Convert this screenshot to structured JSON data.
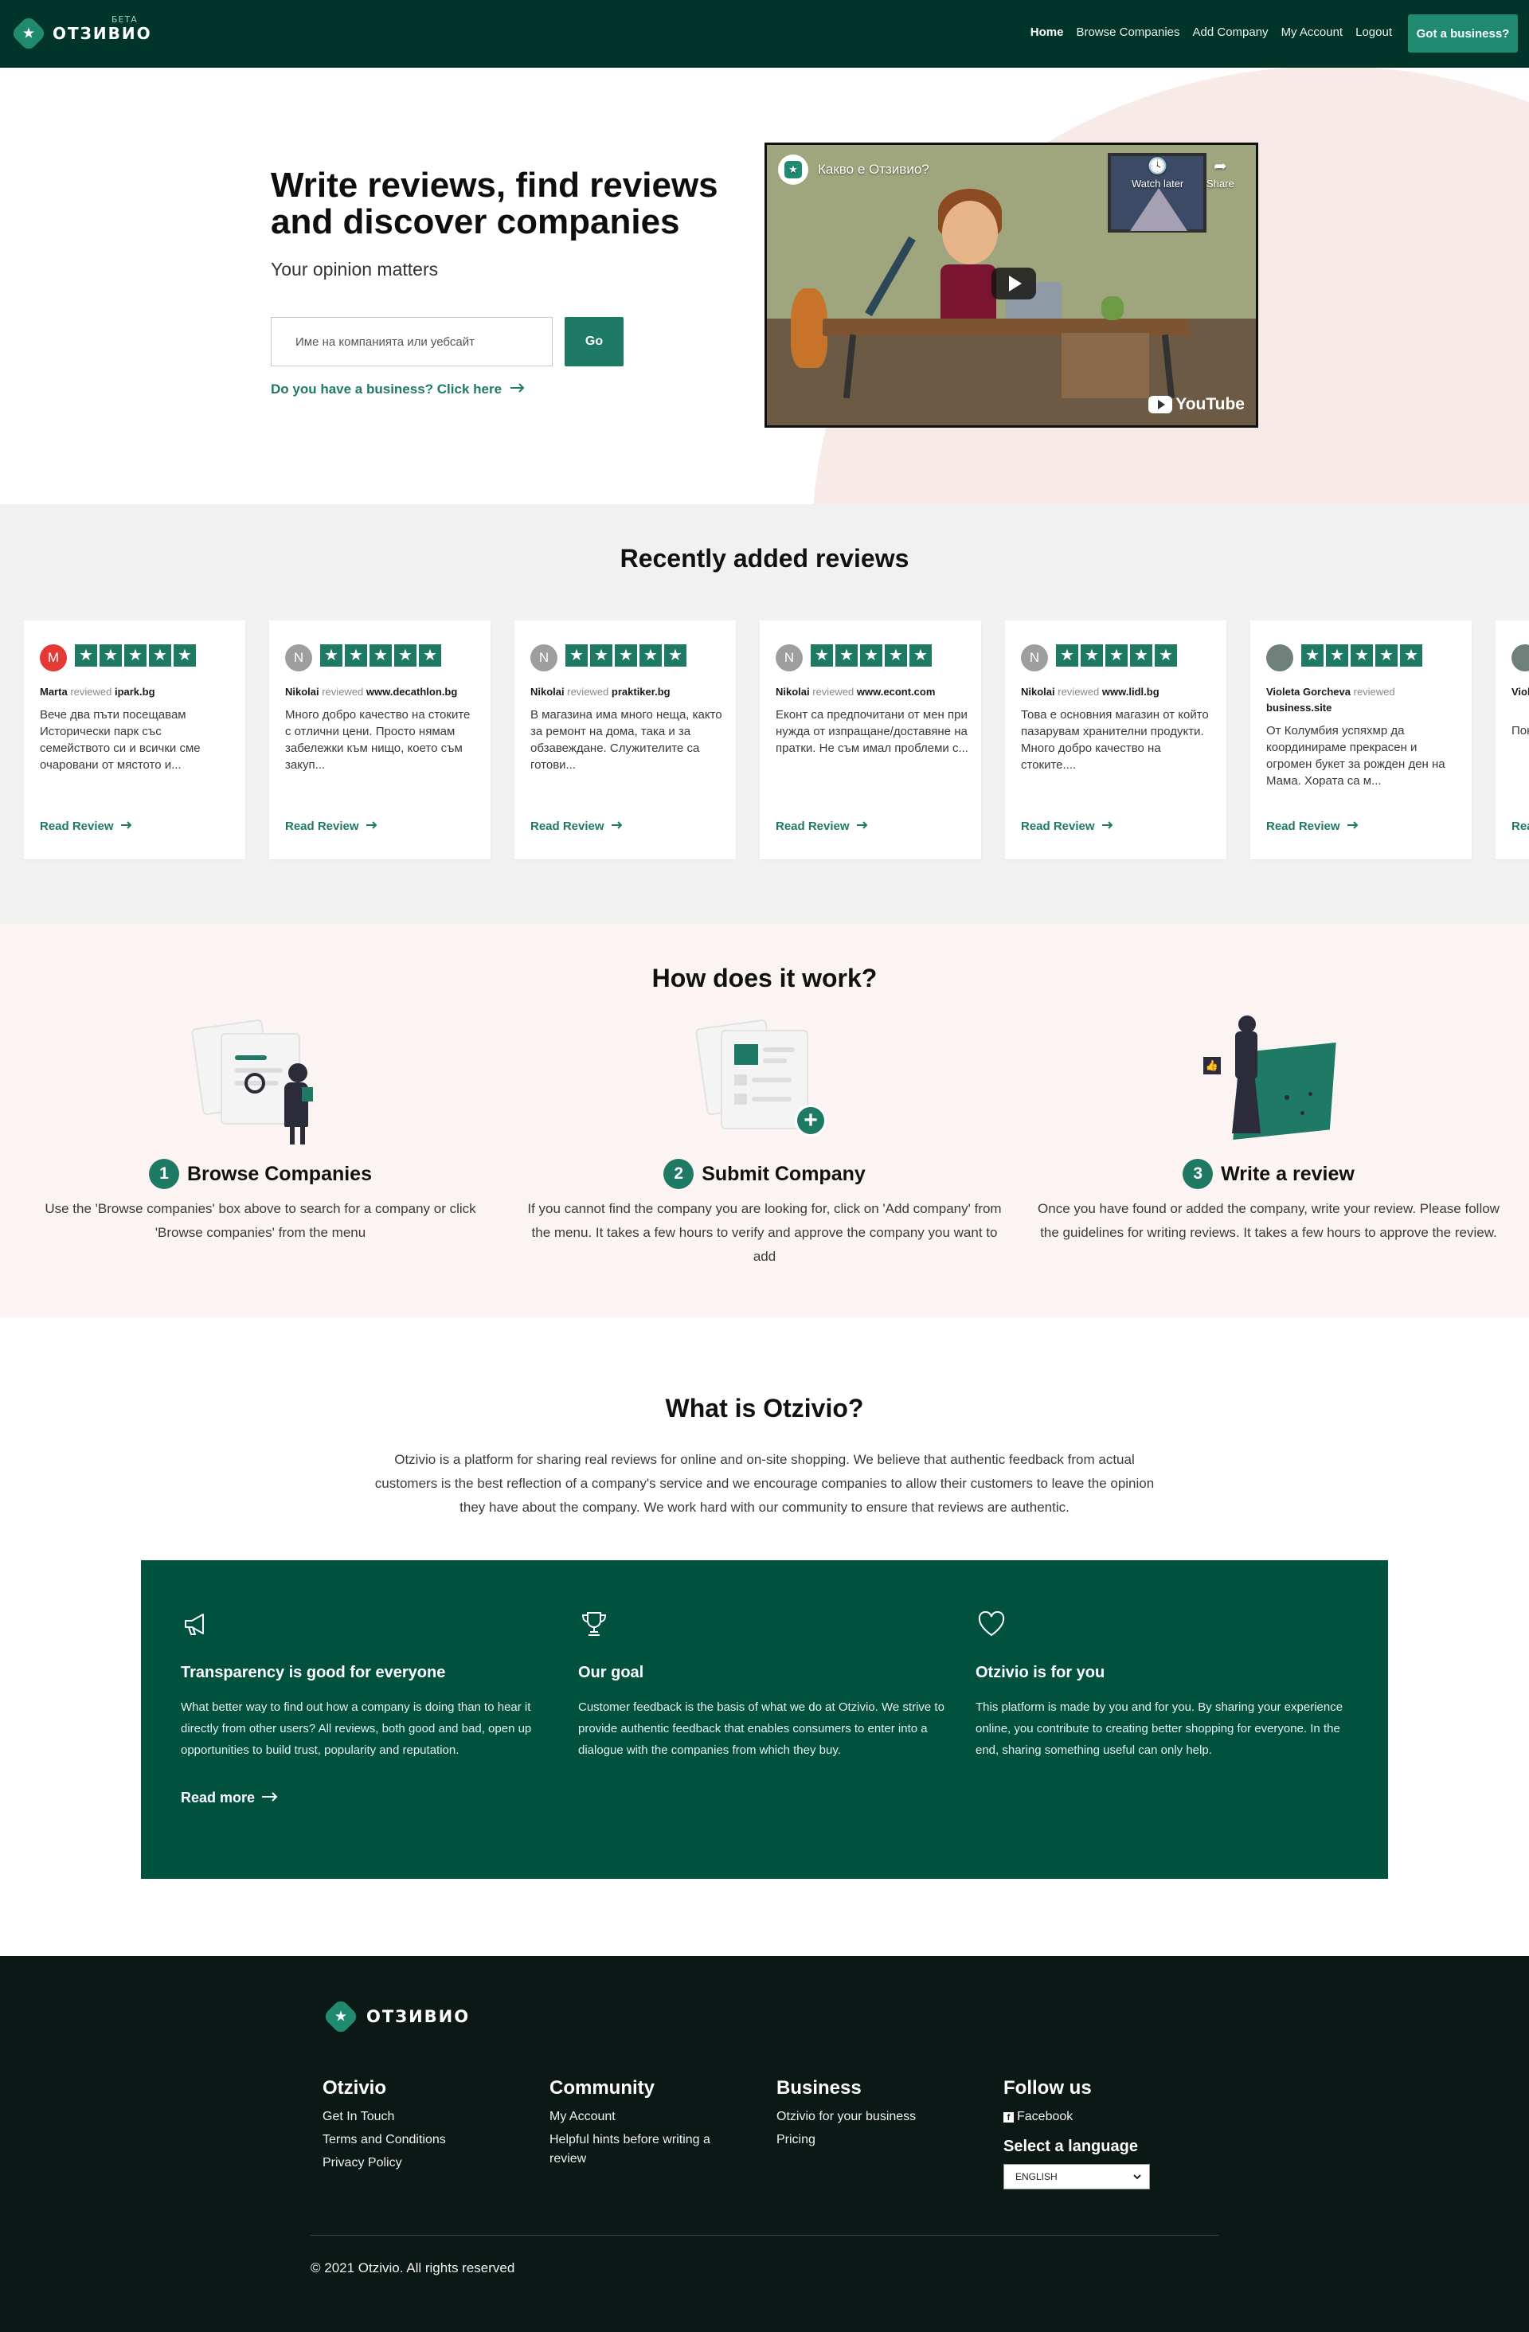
{
  "nav": {
    "logo_text": "ОТЗИВИО",
    "beta_label": "БЕТА",
    "links": [
      "Home",
      "Browse Companies",
      "Add Company",
      "My Account",
      "Logout"
    ],
    "cta": "Got a business?"
  },
  "hero": {
    "title": "Write reviews, find reviews and discover companies",
    "subtitle": "Your opinion matters",
    "search_placeholder": "Име на компанията или уебсайт",
    "go_label": "Go",
    "business_link": "Do you have a business? Click here"
  },
  "video": {
    "title": "Какво е Отзивио?",
    "watch_later": "Watch later",
    "share": "Share",
    "brand": "YouTube"
  },
  "recent": {
    "title": "Recently added reviews",
    "reviewed_word": "reviewed",
    "read_label": "Read Review",
    "cards": [
      {
        "initial": "M",
        "avatar_color": "#e53935",
        "author": "Marta",
        "company": "ipark.bg",
        "text": "Вече два пъти посещавам Исторически парк със семейството си и всички сме очаровани от мястото и..."
      },
      {
        "initial": "N",
        "avatar_color": "#9e9e9e",
        "author": "Nikolai",
        "company": "www.decathlon.bg",
        "text": "Много добро качество на стоките с отлични цени. Просто нямам забележки към нищо, което съм закуп..."
      },
      {
        "initial": "N",
        "avatar_color": "#9e9e9e",
        "author": "Nikolai",
        "company": "praktiker.bg",
        "text": "В магазина има много неща, както за ремонт на дома, така и за обзавеждане. Служителите са готови..."
      },
      {
        "initial": "N",
        "avatar_color": "#9e9e9e",
        "author": "Nikolai",
        "company": "www.econt.com",
        "text": "Еконт са предпочитани от мен при нужда от изпращане/доставяне на пратки. Не съм имал проблеми с..."
      },
      {
        "initial": "N",
        "avatar_color": "#9e9e9e",
        "author": "Nikolai",
        "company": "www.lidl.bg",
        "text": "Това е основния магазин от който пазарувам хранителни продукти. Много добро качество на стоките...."
      },
      {
        "initial": "",
        "avatar_color": "#6f7f7a",
        "author": "Violeta Gorcheva",
        "company": "business.site",
        "text": "От Колумбия успяхмр да координираме прекрасен и огромен букет за рожден ден на Мама. Хората са м..."
      },
      {
        "initial": "",
        "avatar_color": "#6f7f7a",
        "author": "Viol",
        "company": "ani",
        "text": "Пок цве кра Анг"
      }
    ]
  },
  "how": {
    "title": "How does it work?",
    "steps": [
      {
        "num": "1",
        "title": "Browse Companies",
        "desc": "Use the 'Browse companies' box above to search for a company or click 'Browse companies' from the menu"
      },
      {
        "num": "2",
        "title": "Submit Company",
        "desc": "If you cannot find the company you are looking for, click on 'Add company' from the menu. It takes a few hours to verify and approve the company you want to add"
      },
      {
        "num": "3",
        "title": "Write a review",
        "desc": "Once you have found or added the company, write your review. Please follow the guidelines for writing reviews. It takes a few hours to approve the review."
      }
    ]
  },
  "whatis": {
    "title": "What is Otzivio?",
    "text": "Otzivio is a platform for sharing real reviews for online and on-site shopping. We believe that authentic feedback from actual customers is the best reflection of a company's service and we encourage companies to allow their customers to leave the opinion they have about the company. We work hard with our community to ensure that reviews are authentic.",
    "features": [
      {
        "icon": "megaphone-icon",
        "title": "Transparency is good for everyone",
        "text": "What better way to find out how a company is doing than to hear it directly from other users? All reviews, both good and bad, open up opportunities to build trust, popularity and reputation.",
        "more": "Read more"
      },
      {
        "icon": "trophy-icon",
        "title": "Our goal",
        "text": "Customer feedback is the basis of what we do at Otzivio. We strive to provide authentic feedback that enables consumers to enter into a dialogue with the companies from which they buy."
      },
      {
        "icon": "heart-icon",
        "title": "Otzivio is for you",
        "text": "This platform is made by you and for you. By sharing your experience online, you contribute to creating better shopping for everyone. In the end, sharing something useful can only help."
      }
    ]
  },
  "footer": {
    "logo_text": "ОТЗИВИО",
    "columns": [
      {
        "heading": "Otzivio",
        "links": [
          "Get In Touch",
          "Terms and Conditions",
          "Privacy Policy"
        ]
      },
      {
        "heading": "Community",
        "links": [
          "My Account",
          "Helpful hints before writing a review"
        ]
      },
      {
        "heading": "Business",
        "links": [
          "Otzivio for your business",
          "Pricing"
        ]
      },
      {
        "heading": "Follow us",
        "links": [
          "Facebook"
        ]
      }
    ],
    "language_heading": "Select a language",
    "language_value": "ENGLISH",
    "copyright": "© 2021 Otzivio. All rights reserved"
  },
  "colors": {
    "nav_bg": "#01352a",
    "accent": "#1f7a65",
    "panel": "#01513f",
    "footer_bg": "#0c1816"
  }
}
